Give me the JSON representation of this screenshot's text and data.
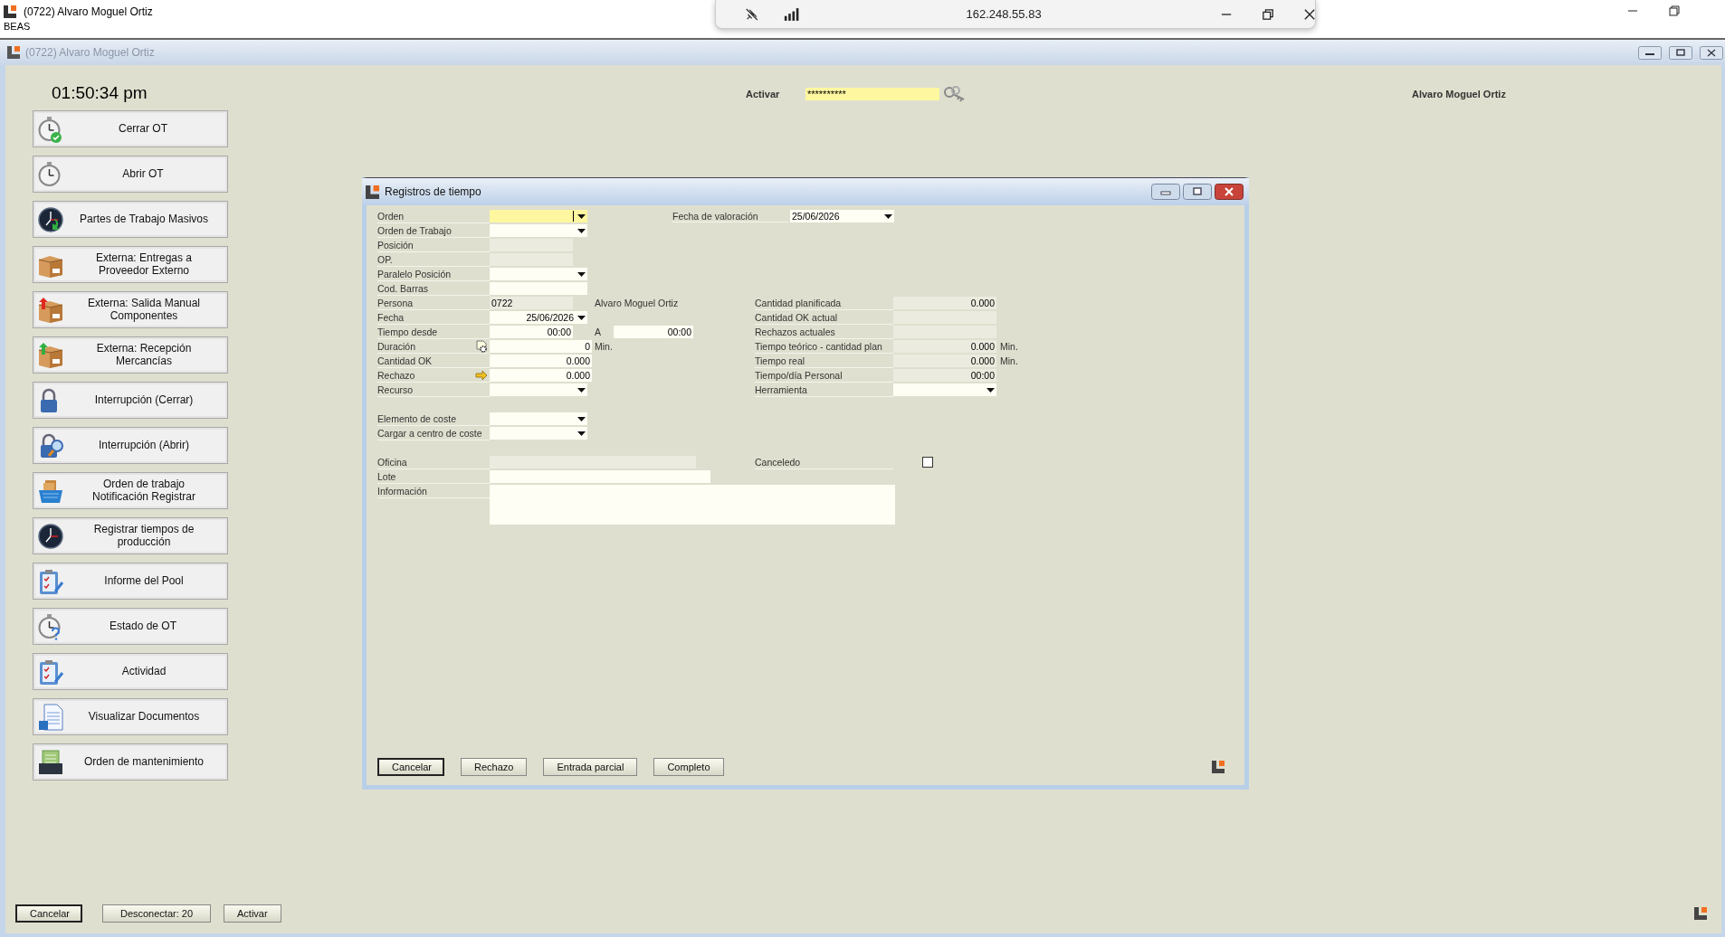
{
  "outer_window": {
    "title": "(0722) Alvaro Moguel Ortiz",
    "subtitle": "BEAS"
  },
  "remote_bar": {
    "address": "162.248.55.83"
  },
  "app_window": {
    "title": "(0722) Alvaro Moguel Ortiz"
  },
  "clock": "01:50:34 pm",
  "menu_buttons": [
    {
      "label": "Cerrar OT"
    },
    {
      "label": "Abrir OT"
    },
    {
      "label": "Partes de Trabajo Masivos"
    },
    {
      "label": "Externa: Entregas a Proveedor Externo"
    },
    {
      "label": "Externa: Salida Manual Componentes"
    },
    {
      "label": "Externa: Recepción Mercancías"
    },
    {
      "label": "Interrupción (Cerrar)"
    },
    {
      "label": "Interrupción (Abrir)"
    },
    {
      "label": "Orden de trabajo Notificación Registrar"
    },
    {
      "label": "Registrar tiempos de producción"
    },
    {
      "label": "Informe del Pool"
    },
    {
      "label": "Estado de OT"
    },
    {
      "label": "Actividad"
    },
    {
      "label": "Visualizar Documentos"
    },
    {
      "label": "Orden de mantenimiento"
    }
  ],
  "activation": {
    "label": "Activar",
    "value": "**********"
  },
  "user_name": "Alvaro Moguel Ortiz",
  "dialog": {
    "title": "Registros de tiempo",
    "sections": [
      [
        {
          "left": {
            "label": "Orden",
            "kind": "combo",
            "focused": true
          },
          "aside": {
            "label": "Fecha de valoración",
            "kind": "combo",
            "value": "25/06/2026"
          }
        },
        {
          "left": {
            "label": "Orden de Trabajo",
            "kind": "combo",
            "focused": false
          }
        },
        {
          "left": {
            "label": "Posición",
            "kind": "readonly",
            "focused": false
          }
        },
        {
          "left": {
            "label": "OP.",
            "kind": "readonly",
            "focused": false
          }
        },
        {
          "left": {
            "label": "Paralelo Posición",
            "kind": "combo",
            "focused": false
          }
        },
        {
          "left": {
            "label": "Cod. Barras",
            "kind": "text",
            "focused": false
          }
        },
        {
          "left": {
            "label": "Persona",
            "kind": "readonly",
            "value": "0722",
            "focused": false
          },
          "middle": {
            "kind": "text",
            "text": "Alvaro Moguel Ortiz"
          },
          "right": {
            "label": "Cantidad planificada",
            "kind": "readonly",
            "value": "0.000"
          }
        },
        {
          "left": {
            "label": "Fecha",
            "kind": "combo",
            "value": "25/06/2026",
            "focused": false
          },
          "right": {
            "label": "Cantidad OK actual",
            "kind": "readonly"
          }
        },
        {
          "left": {
            "label": "Tiempo desde",
            "kind": "time",
            "value": "00:00",
            "focused": false
          },
          "middle": {
            "kind": "field",
            "label": "A",
            "value": "00:00"
          },
          "right": {
            "label": "Rechazos actuales",
            "kind": "readonly"
          }
        },
        {
          "left": {
            "label": "Duración",
            "kind": "number",
            "value": "0",
            "focused": false
          },
          "middle": {
            "kind": "text",
            "text": "Min."
          },
          "right": {
            "label": "Tiempo teórico - cantidad plan",
            "kind": "readonly",
            "value": "0.000",
            "unit": "Min."
          }
        },
        {
          "left": {
            "label": "Cantidad OK",
            "kind": "number",
            "value": "0.000",
            "focused": false
          },
          "right": {
            "label": "Tiempo real",
            "kind": "readonly",
            "value": "0.000",
            "unit": "Min."
          }
        },
        {
          "left": {
            "label": "Rechazo",
            "kind": "number",
            "value": "0.000",
            "focused": false
          },
          "right": {
            "label": "Tiempo/día Personal",
            "kind": "readonly",
            "value": "00:00"
          }
        },
        {
          "left": {
            "label": "Recurso",
            "kind": "combo",
            "focused": false
          },
          "right": {
            "label": "Herramienta",
            "kind": "combo"
          }
        }
      ],
      [
        {
          "left": {
            "label": "Elemento de coste",
            "kind": "combo",
            "focused": false
          }
        },
        {
          "left": {
            "label": "Cargar a centro de coste",
            "kind": "combo",
            "focused": false
          }
        }
      ],
      [
        {
          "left": {
            "label": "Oficina",
            "kind": "wide-readonly",
            "focused": false
          },
          "right": {
            "label": "Canceledo",
            "kind": "checkbox",
            "checked": false
          }
        },
        {
          "left": {
            "label": "Lote",
            "kind": "wide-text",
            "focused": false
          }
        },
        {
          "left": {
            "label": "Información",
            "kind": "memo",
            "focused": false
          }
        }
      ]
    ],
    "buttons": [
      {
        "label": "Cancelar",
        "default": true
      },
      {
        "label": "Rechazo",
        "default": false
      },
      {
        "label": "Entrada parcial",
        "default": false
      },
      {
        "label": "Completo",
        "default": false
      }
    ]
  },
  "footer_buttons": [
    {
      "label": "Cancelar",
      "default": true
    },
    {
      "label": "Desconectar: 20",
      "default": false
    },
    {
      "label": "Activar",
      "default": false
    }
  ]
}
